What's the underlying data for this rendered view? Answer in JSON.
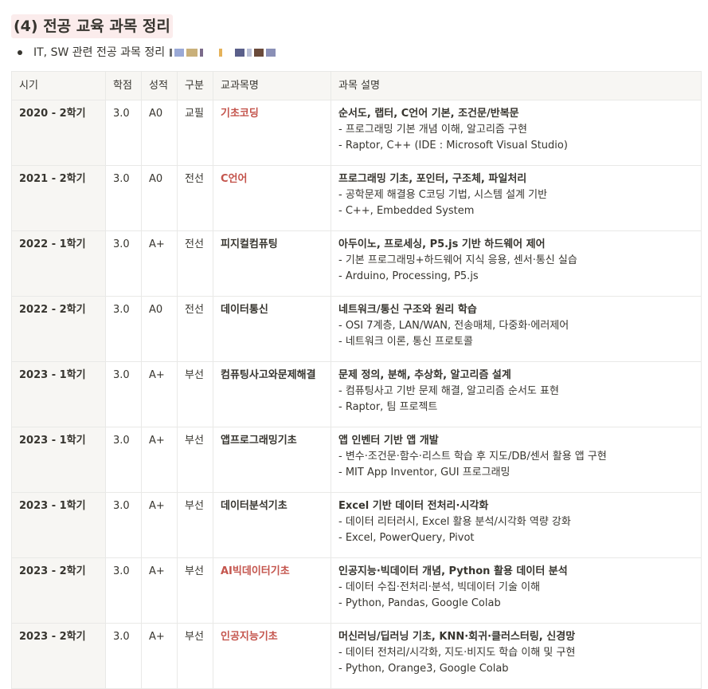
{
  "heading": "(4) 전공 교육 과목 정리",
  "bullet": {
    "text": "IT, SW 관련 전공 과목 정리"
  },
  "table": {
    "headers": [
      "시기",
      "학점",
      "성적",
      "구분",
      "교과목명",
      "과목 설명"
    ],
    "rows": [
      {
        "period": "2020 - 2학기",
        "credit": "3.0",
        "grade": "A0",
        "type": "교필",
        "course": "기초코딩",
        "highlight": true,
        "desc_title": "순서도, 랩터, C언어 기본, 조건문/반복문",
        "desc_lines": [
          "- 프로그래밍 기본 개념 이해, 알고리즘 구현",
          "- Raptor, C++ (IDE : Microsoft Visual Studio)"
        ]
      },
      {
        "period": "2021 - 2학기",
        "credit": "3.0",
        "grade": "A0",
        "type": "전선",
        "course": "C언어",
        "highlight": true,
        "desc_title": "프로그래밍 기초, 포인터, 구조체, 파일처리",
        "desc_lines": [
          "- 공학문제 해결용 C코딩 기법, 시스템 설계 기반",
          "- C++, Embedded System"
        ]
      },
      {
        "period": "2022 - 1학기",
        "credit": "3.0",
        "grade": "A+",
        "type": "전선",
        "course": "피지컬컴퓨팅",
        "highlight": false,
        "desc_title": "아두이노, 프로세싱, P5.js 기반 하드웨어 제어",
        "desc_lines": [
          "- 기본 프로그래밍+하드웨어 지식 응용, 센서·통신 실습",
          "- Arduino, Processing, P5.js"
        ]
      },
      {
        "period": "2022 - 2학기",
        "credit": "3.0",
        "grade": "A0",
        "type": "전선",
        "course": "데이터통신",
        "highlight": false,
        "desc_title": "네트워크/통신 구조와 원리 학습",
        "desc_lines": [
          "- OSI 7계층, LAN/WAN, 전송매체, 다중화·에러제어",
          "- 네트워크 이론, 통신 프로토콜"
        ]
      },
      {
        "period": "2023 - 1학기",
        "credit": "3.0",
        "grade": "A+",
        "type": "부선",
        "course": "컴퓨팅사고와문제해결",
        "highlight": false,
        "desc_title": "문제 정의, 분해, 추상화, 알고리즘 설계",
        "desc_lines": [
          "- 컴퓨팅사고 기반 문제 해결, 알고리즘 순서도 표현",
          "- Raptor, 팀 프로젝트"
        ]
      },
      {
        "period": "2023 - 1학기",
        "credit": "3.0",
        "grade": "A+",
        "type": "부선",
        "course": "앱프로그래밍기초",
        "highlight": false,
        "desc_title": "앱 인벤터 기반 앱 개발",
        "desc_lines": [
          "- 변수·조건문·함수·리스트 학습 후 지도/DB/센서 활용 앱 구현",
          "- MIT App Inventor, GUI 프로그래밍"
        ]
      },
      {
        "period": "2023 - 1학기",
        "credit": "3.0",
        "grade": "A+",
        "type": "부선",
        "course": "데이터분석기초",
        "highlight": false,
        "desc_title": "Excel 기반 데이터 전처리·시각화",
        "desc_lines": [
          "- 데이터 리터러시, Excel 활용 분석/시각화 역량 강화",
          "- Excel, PowerQuery, Pivot"
        ]
      },
      {
        "period": "2023 - 2학기",
        "credit": "3.0",
        "grade": "A+",
        "type": "부선",
        "course": "AI빅데이터기초",
        "highlight": true,
        "desc_title": "인공지능·빅데이터 개념, Python 활용 데이터 분석",
        "desc_lines": [
          "- 데이터 수집·전처리·분석, 빅데이터 기술 이해",
          "- Python, Pandas, Google Colab"
        ]
      },
      {
        "period": "2023 - 2학기",
        "credit": "3.0",
        "grade": "A+",
        "type": "부선",
        "course": "인공지능기초",
        "highlight": true,
        "desc_title": "머신러닝/딥러닝 기초, KNN·회귀·클러스터링, 신경망",
        "desc_lines": [
          "- 데이터 전처리/시각화, 지도·비지도 학습 이해 및 구현",
          "- Python, Orange3, Google Colab"
        ]
      }
    ]
  },
  "colors": {
    "text": "#37352f",
    "highlight_course": "#c4554d",
    "heading_bg": "#fbecec",
    "header_bg": "#f7f6f3",
    "border": "#e9e9e7"
  }
}
